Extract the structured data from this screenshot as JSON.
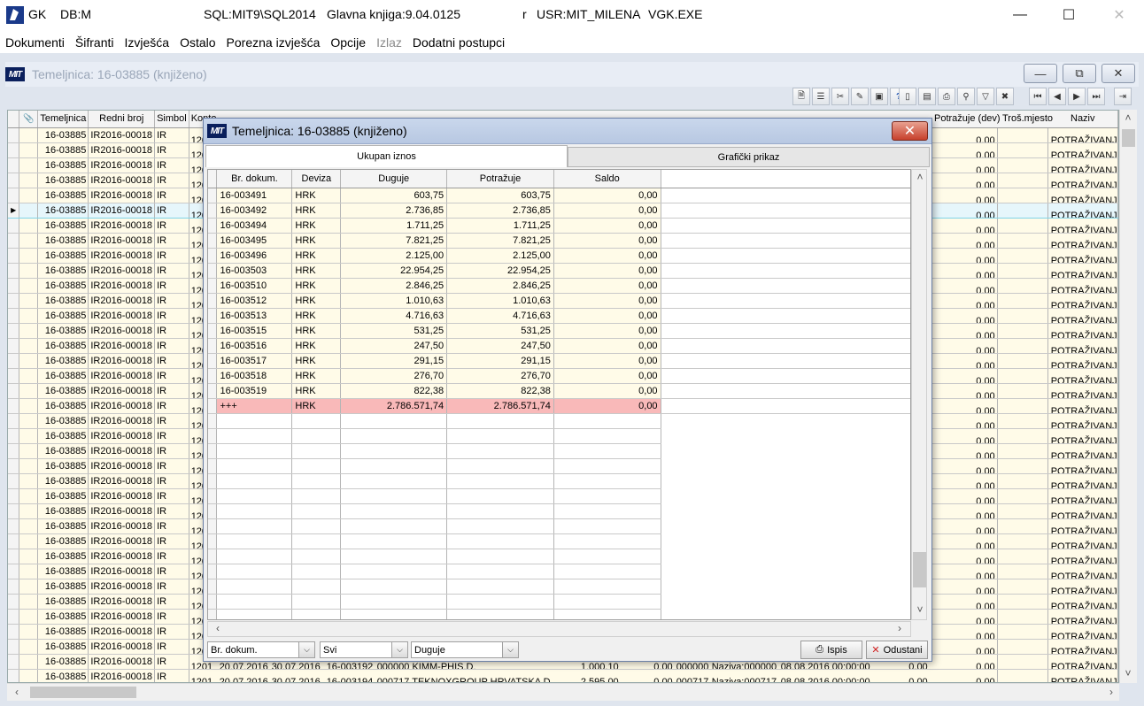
{
  "window": {
    "app": "GK",
    "db": "DB:M",
    "server": "SQL:MIT9\\SQL2014",
    "version": "Glavna knjiga:9.04.0125",
    "r": "r",
    "user": "USR:MIT_MILENA",
    "exe": "VGK.EXE"
  },
  "menu": [
    "Dokumenti",
    "Šifranti",
    "Izvješća",
    "Ostalo",
    "Porezna izvješća",
    "Opcije",
    "Izlaz",
    "Dodatni postupci"
  ],
  "child": {
    "title": "Temeljnica: 16-03885  (knjiženo)",
    "logo": "MIT"
  },
  "bg_grid": {
    "headers": [
      "Temeljnica",
      "Redni broj",
      "Simbol",
      "Konto",
      "Potražuje (dev)",
      "Troš.mjesto",
      "Naziv"
    ],
    "temeljnica": "16-03885",
    "redni_broj": "IR2016-00018",
    "simbol": "IR",
    "konto": "120",
    "potrazuje_dev": "0,00",
    "naziv": "POTRAŽIVANJA",
    "last_row": {
      "konto": "1201",
      "date1": "20.07.2016",
      "date2": "30.07.2016",
      "doc": "16-003194",
      "partner": "000717 TEKNOXGROUP HRVATSKA D.",
      "duguje": "2.595,00",
      "potrazuje": "0,00",
      "sifra": "000717",
      "naziv_p": "Naziva:000717",
      "datum": "08.08.2016 00:00:00",
      "dug_dev": "0,00",
      "pot_dev": "0,00",
      "naziv": "POTRAŽIVANJA"
    },
    "prev_row": {
      "konto": "1201",
      "date1": "20.07.2016",
      "date2": "30.07.2016",
      "doc": "16-003192",
      "partner": "000000 KIMM-PHIS.D.",
      "duguje": "1.000,10",
      "potrazuje": "0,00",
      "sifra": "000000",
      "naziv_p": "Naziva:000000",
      "datum": "08.08.2016 00:00:00",
      "dug_dev": "0,00",
      "pot_dev": "0,00",
      "naziv": "POTRAŽIVANJA"
    }
  },
  "dialog": {
    "title": "Temeljnica: 16-03885  (knjiženo)",
    "logo": "MIT",
    "tabs": [
      "Ukupan iznos",
      "Grafički prikaz"
    ],
    "columns": [
      "Br. dokum.",
      "Deviza",
      "Duguje",
      "Potražuje",
      "Saldo"
    ],
    "rows": [
      [
        "16-003491",
        "HRK",
        "603,75",
        "603,75",
        "0,00"
      ],
      [
        "16-003492",
        "HRK",
        "2.736,85",
        "2.736,85",
        "0,00"
      ],
      [
        "16-003494",
        "HRK",
        "1.711,25",
        "1.711,25",
        "0,00"
      ],
      [
        "16-003495",
        "HRK",
        "7.821,25",
        "7.821,25",
        "0,00"
      ],
      [
        "16-003496",
        "HRK",
        "2.125,00",
        "2.125,00",
        "0,00"
      ],
      [
        "16-003503",
        "HRK",
        "22.954,25",
        "22.954,25",
        "0,00"
      ],
      [
        "16-003510",
        "HRK",
        "2.846,25",
        "2.846,25",
        "0,00"
      ],
      [
        "16-003512",
        "HRK",
        "1.010,63",
        "1.010,63",
        "0,00"
      ],
      [
        "16-003513",
        "HRK",
        "4.716,63",
        "4.716,63",
        "0,00"
      ],
      [
        "16-003515",
        "HRK",
        "531,25",
        "531,25",
        "0,00"
      ],
      [
        "16-003516",
        "HRK",
        "247,50",
        "247,50",
        "0,00"
      ],
      [
        "16-003517",
        "HRK",
        "291,15",
        "291,15",
        "0,00"
      ],
      [
        "16-003518",
        "HRK",
        "276,70",
        "276,70",
        "0,00"
      ],
      [
        "16-003519",
        "HRK",
        "822,38",
        "822,38",
        "0,00"
      ]
    ],
    "total": [
      "+++",
      "HRK",
      "2.786.571,74",
      "2.786.571,74",
      "0,00"
    ],
    "filter1": "Br. dokum.",
    "filter2": "Svi",
    "filter3": "Duguje",
    "print_label": "Ispis",
    "cancel_label": "Odustani"
  }
}
